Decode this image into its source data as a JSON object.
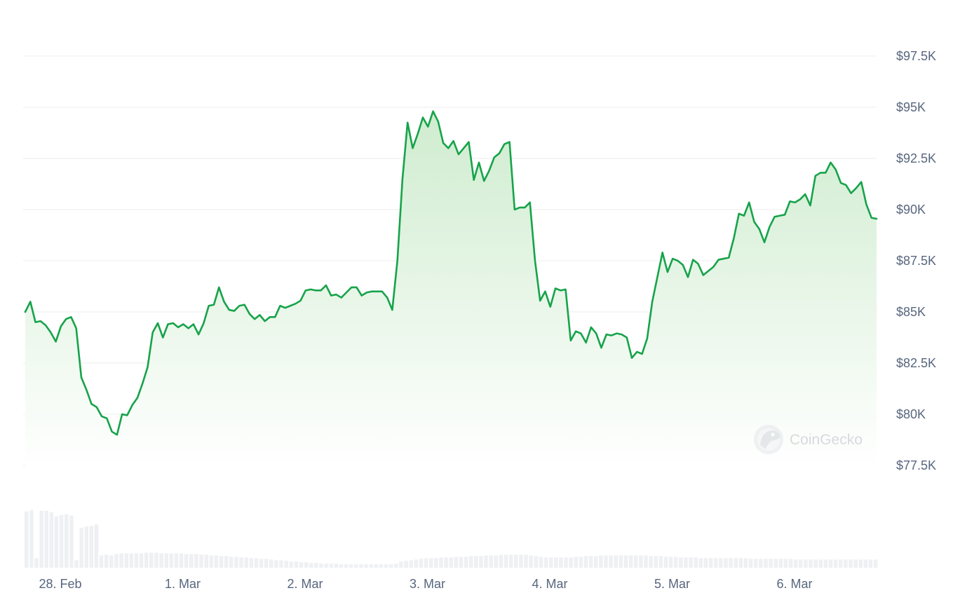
{
  "watermark": {
    "text": "CoinGecko",
    "icon": "gecko-logo-icon"
  },
  "colors": {
    "line": "#16a34a",
    "area_top": "#cfeccf",
    "area_bottom": "#ffffff",
    "grid": "#eceef2",
    "tick_text": "#58667e",
    "volume": "#eff0f3",
    "watermark": "#b9bec7"
  },
  "chart_data": {
    "type": "area",
    "title": "",
    "xlabel": "",
    "ylabel": "",
    "x_range": [
      "27. Feb 21:30",
      "6. Mar 17:30"
    ],
    "ylim": [
      76000,
      98500
    ],
    "y_ticks": [
      {
        "value": 97500,
        "label": "$97.5K"
      },
      {
        "value": 95000,
        "label": "$95K"
      },
      {
        "value": 92500,
        "label": "$92.5K"
      },
      {
        "value": 90000,
        "label": "$90K"
      },
      {
        "value": 87500,
        "label": "$87.5K"
      },
      {
        "value": 85000,
        "label": "$85K"
      },
      {
        "value": 82500,
        "label": "$82.5K"
      },
      {
        "value": 80000,
        "label": "$80K"
      },
      {
        "value": 77500,
        "label": "$77.5K"
      }
    ],
    "x_ticks": [
      {
        "label": "28. Feb",
        "day": 1
      },
      {
        "label": "1. Mar",
        "day": 2
      },
      {
        "label": "2. Mar",
        "day": 3
      },
      {
        "label": "3. Mar",
        "day": 4
      },
      {
        "label": "4. Mar",
        "day": 5
      },
      {
        "label": "5. Mar",
        "day": 6
      },
      {
        "label": "6. Mar",
        "day": 7
      }
    ],
    "grid": true,
    "series": [
      {
        "values": [
          85000,
          85500,
          84500,
          84550,
          84350,
          84000,
          83550,
          84300,
          84650,
          84750,
          84200,
          81800,
          81200,
          80500,
          80350,
          79900,
          79800,
          79150,
          79000,
          80000,
          79950,
          80450,
          80800,
          81500,
          82300,
          84000,
          84450,
          83750,
          84400,
          84450,
          84250,
          84400,
          84200,
          84400,
          83900,
          84450,
          85300,
          85350,
          86200,
          85500,
          85100,
          85050,
          85300,
          85350,
          84900,
          84650,
          84850,
          84550,
          84750,
          84750,
          85300,
          85200,
          85300,
          85400,
          85550,
          86050,
          86100,
          86050,
          86050,
          86300,
          85800,
          85850,
          85700,
          85950,
          86200,
          86200,
          85800,
          85950,
          86000,
          86000,
          86000,
          85700,
          85100,
          87500,
          91500,
          94250,
          93000,
          93700,
          94500,
          94050,
          94800,
          94300,
          93250,
          93000,
          93350,
          92700,
          93000,
          93300,
          91450,
          92300,
          91400,
          91900,
          92550,
          92750,
          93200,
          93300,
          90000,
          90100,
          90100,
          90350,
          87500,
          85550,
          86000,
          85250,
          86150,
          86050,
          86100,
          83600,
          84050,
          83950,
          83500,
          84250,
          83950,
          83250,
          83900,
          83850,
          83950,
          83900,
          83750,
          82750,
          83050,
          82950,
          83700,
          85500,
          86700,
          87900,
          86950,
          87600,
          87500,
          87300,
          86700,
          87550,
          87350,
          86800,
          87000,
          87200,
          87550,
          87600,
          87650,
          88600,
          89800,
          89700,
          90350,
          89400,
          89050,
          88400,
          89150,
          89650,
          89700,
          89750,
          90400,
          90350,
          90500,
          90750,
          90200,
          91650,
          91800,
          91800,
          92300,
          91950,
          91300,
          91200,
          90800,
          91050,
          91350,
          90250,
          89600,
          89550
        ],
        "volume": [
          0.82,
          0.84,
          0.14,
          0.83,
          0.83,
          0.81,
          0.75,
          0.77,
          0.78,
          0.76,
          0.11,
          0.58,
          0.6,
          0.61,
          0.63,
          0.18,
          0.19,
          0.18,
          0.2,
          0.21,
          0.21,
          0.21,
          0.21,
          0.21,
          0.22,
          0.22,
          0.22,
          0.21,
          0.21,
          0.21,
          0.21,
          0.21,
          0.2,
          0.2,
          0.2,
          0.19,
          0.19,
          0.18,
          0.18,
          0.17,
          0.17,
          0.16,
          0.16,
          0.15,
          0.15,
          0.14,
          0.14,
          0.13,
          0.13,
          0.12,
          0.11,
          0.11,
          0.1,
          0.09,
          0.09,
          0.08,
          0.08,
          0.07,
          0.07,
          0.06,
          0.06,
          0.06,
          0.06,
          0.05,
          0.05,
          0.05,
          0.05,
          0.05,
          0.05,
          0.05,
          0.05,
          0.05,
          0.05,
          0.05,
          0.06,
          0.09,
          0.1,
          0.11,
          0.12,
          0.13,
          0.14,
          0.14,
          0.14,
          0.15,
          0.15,
          0.15,
          0.16,
          0.16,
          0.16,
          0.17,
          0.17,
          0.17,
          0.18,
          0.18,
          0.18,
          0.19,
          0.19,
          0.19,
          0.19,
          0.19,
          0.19,
          0.18,
          0.17,
          0.16,
          0.15,
          0.15,
          0.15,
          0.15,
          0.15,
          0.15,
          0.16,
          0.16,
          0.17,
          0.17,
          0.17,
          0.18,
          0.18,
          0.18,
          0.18,
          0.18,
          0.18,
          0.18,
          0.18,
          0.18,
          0.18,
          0.17,
          0.17,
          0.17,
          0.16,
          0.16,
          0.16,
          0.15,
          0.15,
          0.15,
          0.15,
          0.14,
          0.14,
          0.14,
          0.14,
          0.14,
          0.14,
          0.14,
          0.14,
          0.14,
          0.14,
          0.13,
          0.13,
          0.13,
          0.13,
          0.13,
          0.13,
          0.13,
          0.13,
          0.13,
          0.12,
          0.12,
          0.12,
          0.12,
          0.12,
          0.12,
          0.12,
          0.12,
          0.12,
          0.12,
          0.12,
          0.12,
          0.12,
          0.12,
          0.12,
          0.12,
          0.12
        ]
      }
    ]
  }
}
